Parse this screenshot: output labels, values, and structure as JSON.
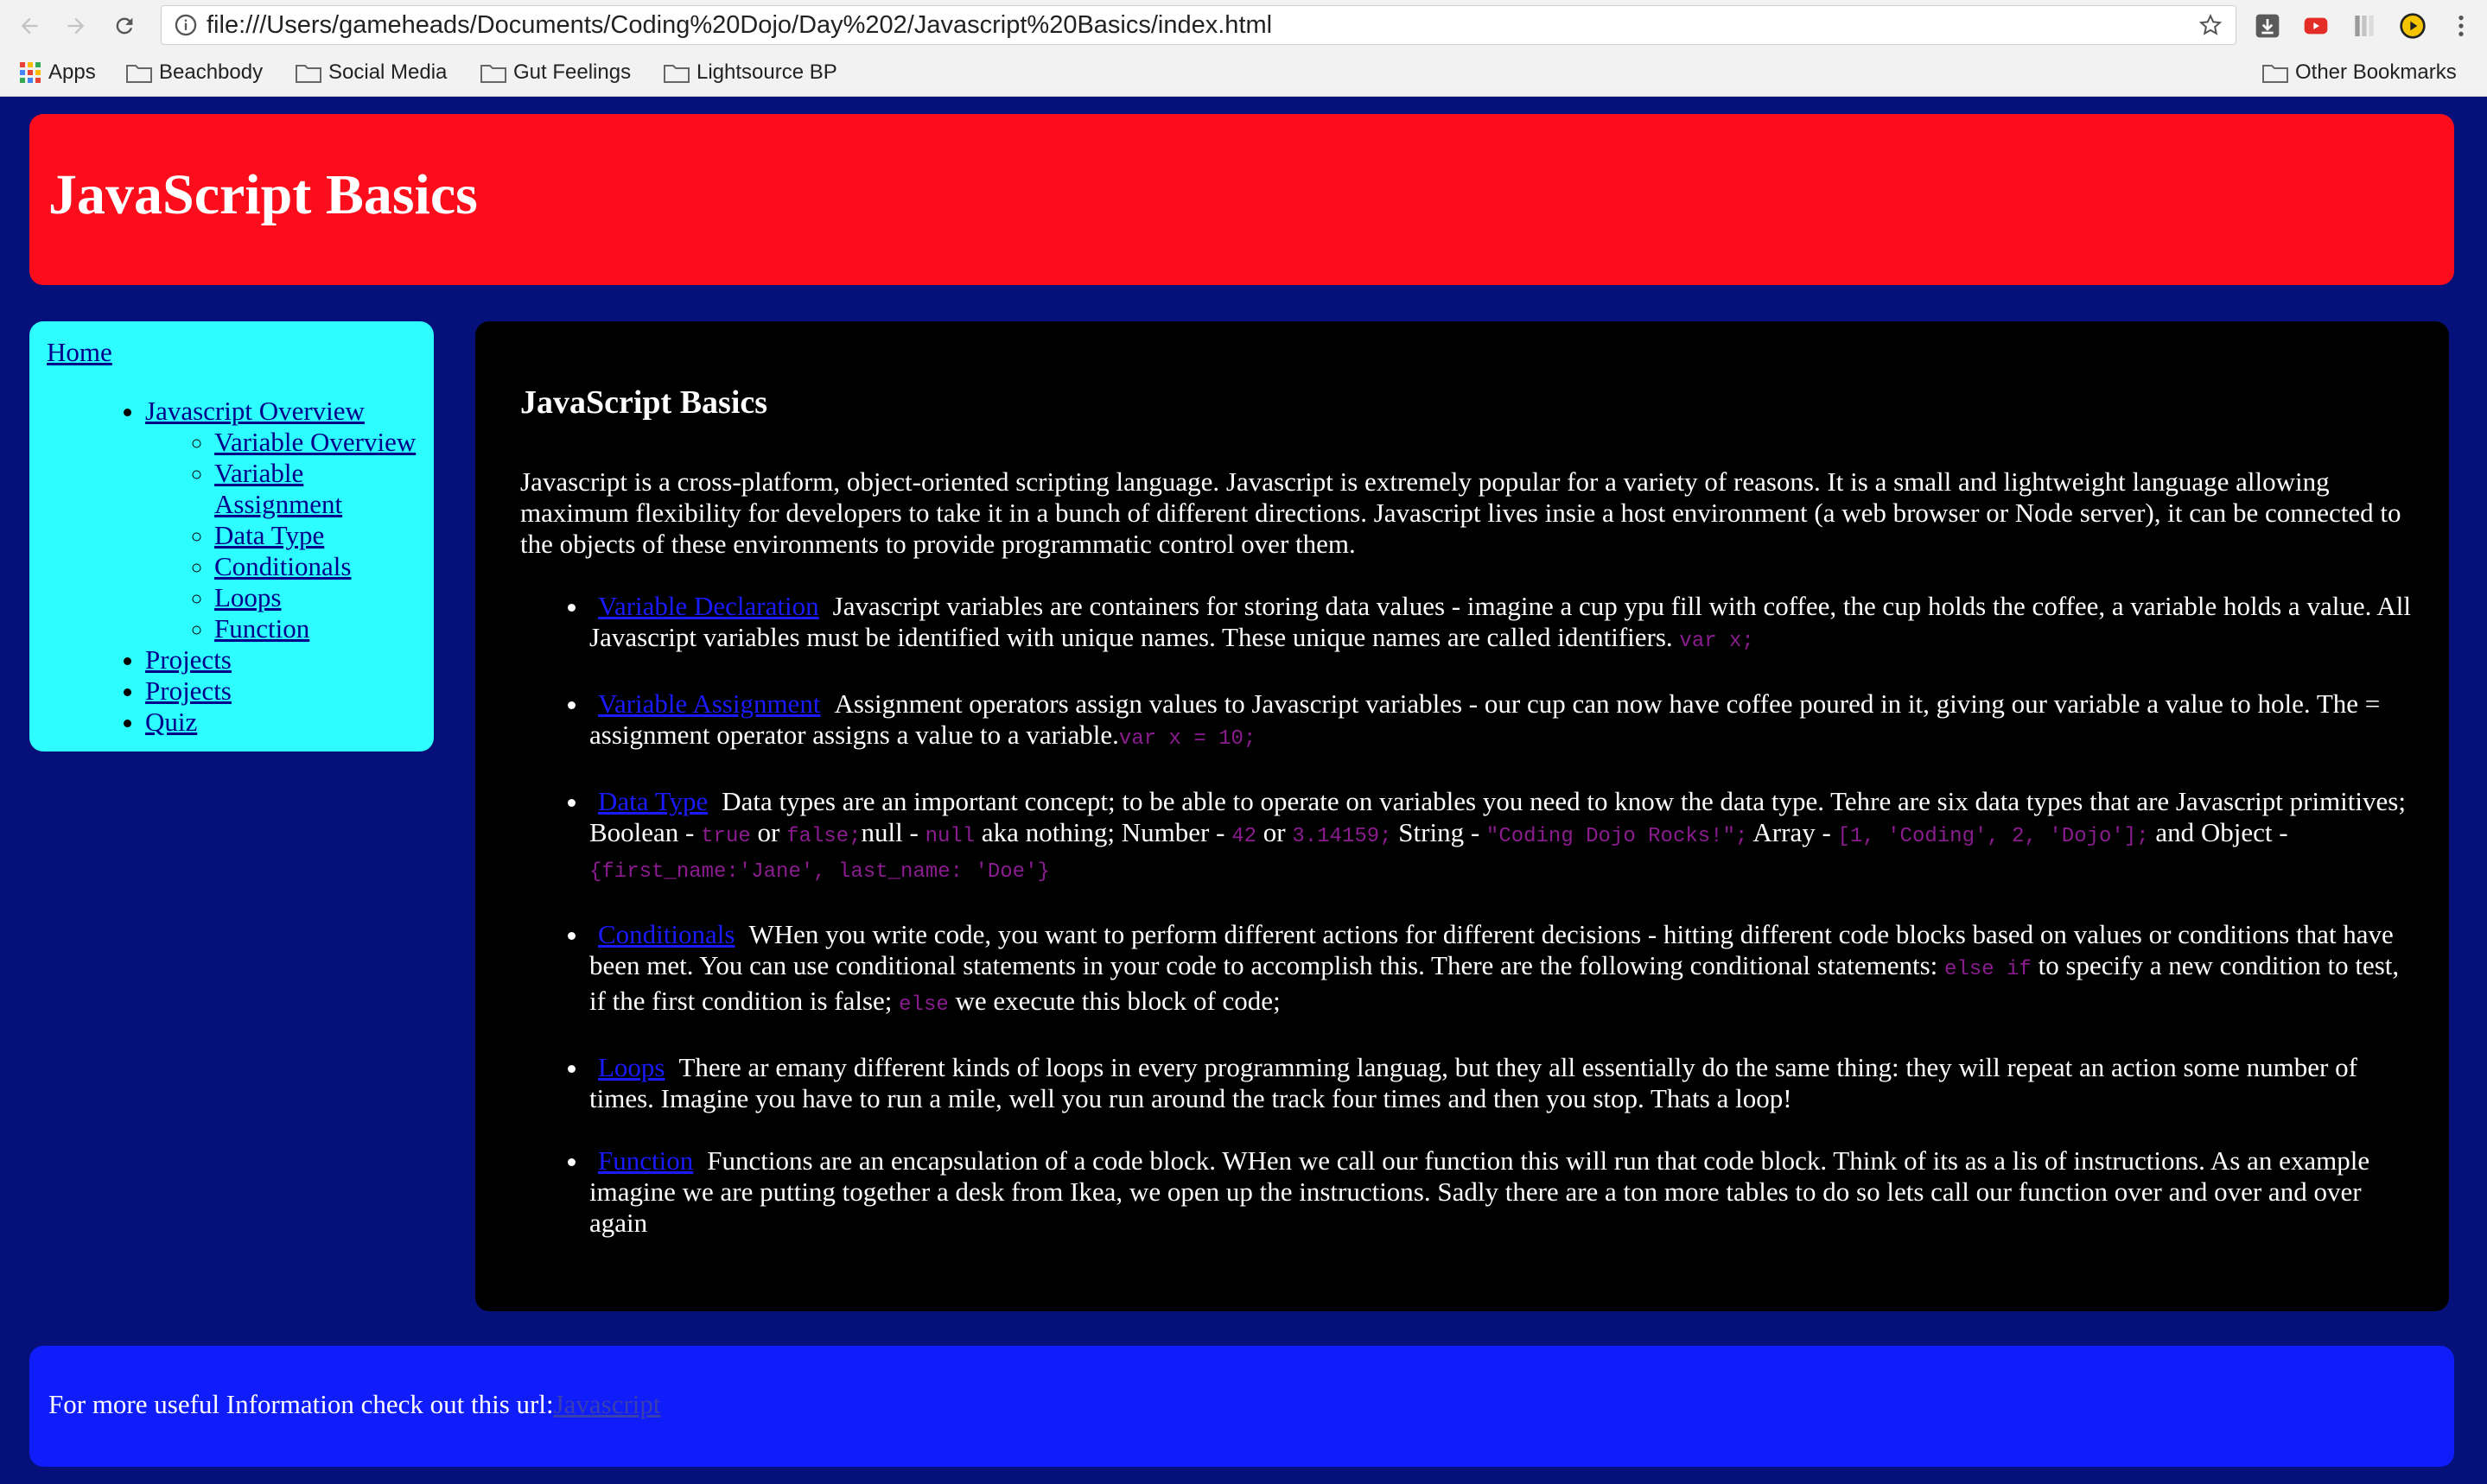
{
  "browser": {
    "url": "file:///Users/gameheads/Documents/Coding%20Dojo/Day%202/Javascript%20Basics/index.html",
    "bookmarks": [
      "Apps",
      "Beachbody",
      "Social Media",
      "Gut Feelings",
      "Lightsource BP"
    ],
    "other_bookmarks": "Other Bookmarks"
  },
  "header": {
    "title": "JavaScript Basics"
  },
  "sidebar": {
    "home": "Home",
    "overview": "Javascript Overview",
    "sub_items": [
      "Variable Overview",
      "Variable Assignment",
      "Data Type",
      "Conditionals",
      "Loops",
      "Function"
    ],
    "bottom_items": [
      "Projects",
      "Projects",
      "Quiz"
    ]
  },
  "main": {
    "title": "JavaScript Basics",
    "intro": "Javascript is a cross-platform, object-oriented scripting language. Javascript is extremely popular for a variety of reasons. It is a small and lightweight language allowing maximum flexibility for developers to take it in a bunch of different directions. Javascript lives insie a host environment (a web browser or Node server), it can be connected to the objects of these environments to provide programmatic control over them.",
    "items": [
      {
        "link": "Variable Declaration",
        "text": "Javascript variables are containers for storing data values - imagine a cup ypu fill with coffee, the cup holds the coffee, a variable holds a value. All Javascript variables must be identified with unique names. These unique names are called identifiers.",
        "code": "var x;"
      },
      {
        "link": "Variable Assignment",
        "text": "Assignment operators assign values to Javascript variables - our cup can now have coffee poured in it, giving our variable a value to hole. The = assignment operator assigns a value to a variable.",
        "code": "var x = 10;"
      },
      {
        "link": "Data Type",
        "text": "Data types are an important concept; to be able to operate on variables you need to know the data type. Tehre are six data types that are Javascript primitives; Boolean -",
        "code_true": "true",
        "or1": "or",
        "code_false": "false;",
        "null_text": "null -",
        "code_null": "null",
        "aka": "aka nothing; Number -",
        "code_42": "42",
        "or2": "or",
        "code_pi": "3.14159;",
        "string_text": "String -",
        "code_string": "\"Coding Dojo Rocks!\";",
        "array_text": "Array -",
        "code_array": "[1, 'Coding', 2, 'Dojo'];",
        "object_text": "and Object -",
        "code_object": "{first_name:'Jane', last_name: 'Doe'}"
      },
      {
        "link": "Conditionals",
        "text": "WHen you write code, you want to perform different actions for different decisions - hitting different code blocks based on values or conditions that have been met. You can use conditional statements in your code to accomplish this. There are the following conditional statements:",
        "code_elseif": "else if",
        "text2": "to specify a new condition to test, if the first condition is false;",
        "code_else": "else",
        "text3": "we execute this block of code;"
      },
      {
        "link": "Loops",
        "text": "There ar emany different kinds of loops in every programming languag, but they all essentially do the same thing: they will repeat an action some number of times. Imagine you have to run a mile, well you run around the track four times and then you stop. Thats a loop!"
      },
      {
        "link": "Function",
        "text": "Functions are an encapsulation of a code block. WHen we call our function this will run that code block. Think of its as a lis of instructions. As an example imagine we are putting together a desk from Ikea, we open up the instructions. Sadly there are a ton more tables to do so lets call our function over and over and over again"
      }
    ]
  },
  "footer": {
    "text": "For more useful Information check out this url:",
    "link": "Javascript"
  },
  "colors": {
    "page_bg": "#06107a",
    "header_bg": "#fc0d1b",
    "sidebar_bg": "#2dfdff",
    "main_bg": "#000000",
    "footer_bg": "#0f1dfa",
    "code": "#8b1c8f"
  }
}
